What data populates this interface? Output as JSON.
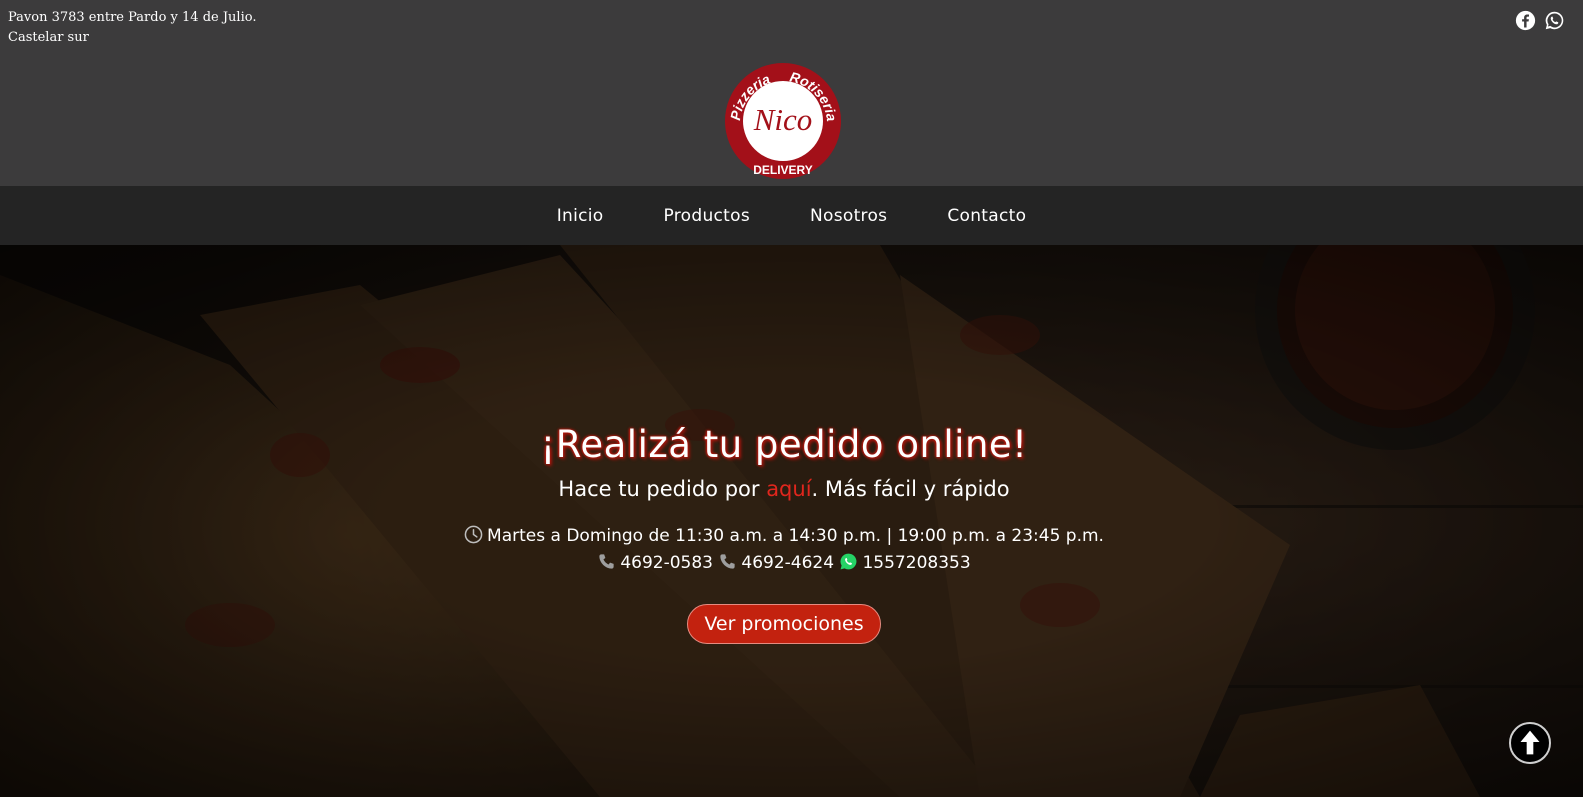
{
  "header": {
    "address_line1": "Pavon 3783 entre Pardo y 14 de Julio.",
    "address_line2": "Castelar sur",
    "social": [
      {
        "name": "facebook-icon"
      },
      {
        "name": "whatsapp-icon"
      }
    ],
    "logo": {
      "top_text_left": "Pizzeria",
      "top_text_right": "Rotiseria",
      "center_text": "Nico",
      "bottom_text": "DELIVERY"
    }
  },
  "nav": {
    "items": [
      {
        "label": "Inicio"
      },
      {
        "label": "Productos"
      },
      {
        "label": "Nosotros"
      },
      {
        "label": "Contacto"
      }
    ]
  },
  "hero": {
    "headline": "¡Realizá tu pedido online!",
    "sub_before": "Hace tu pedido por ",
    "sub_link": "aquí",
    "sub_after": ". Más fácil y rápido",
    "hours": "Martes a Domingo de 11:30 a.m. a 14:30 p.m. | 19:00 p.m. a 23:45 p.m.",
    "phone1": "4692-0583",
    "phone2": "4692-4624",
    "whatsapp": "1557208353",
    "cta_label": "Ver promociones"
  },
  "colors": {
    "accent_red": "#c3220f",
    "header_bg": "#3c3b3c",
    "nav_bg": "#242424",
    "logo_red": "#a31019",
    "whatsapp_green": "#25d366"
  }
}
